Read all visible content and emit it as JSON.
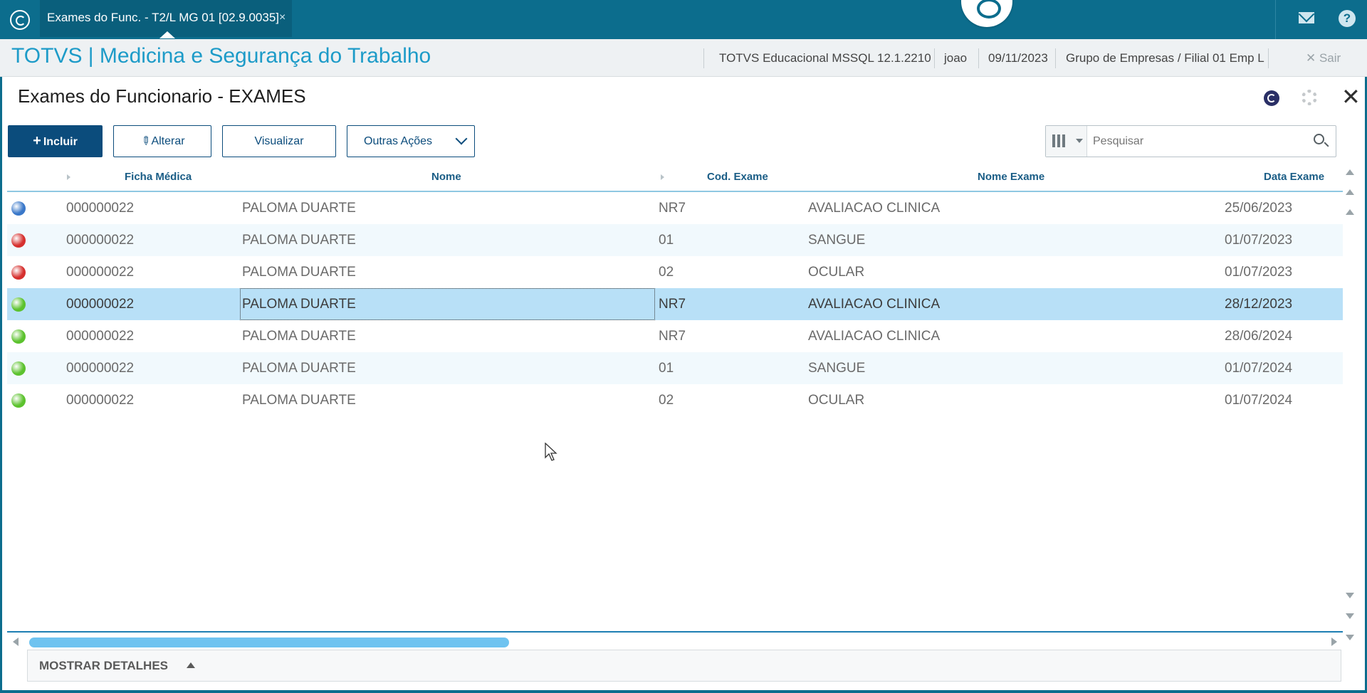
{
  "topbar": {
    "tab_label": "Exames do Func. - T2/L MG 01  [02.9.0035]",
    "tab_close": "×"
  },
  "header": {
    "title": "TOTVS | Medicina e Segurança do Trabalho",
    "environment": "TOTVS Educacional MSSQL 12.1.2210",
    "user": "joao",
    "date": "09/11/2023",
    "company": "Grupo de Empresas / Filial 01 Emp L",
    "exit_label": "Sair"
  },
  "page": {
    "title": "Exames do Funcionario - EXAMES"
  },
  "toolbar": {
    "include_label": "Incluir",
    "edit_label": "Alterar",
    "view_label": "Visualizar",
    "other_label": "Outras Ações"
  },
  "search": {
    "placeholder": "Pesquisar"
  },
  "grid": {
    "columns": [
      "Ficha Médica",
      "Nome",
      "Cod. Exame",
      "Nome Exame",
      "Data Exame"
    ],
    "rows": [
      {
        "status": "blue",
        "ficha": "000000022",
        "nome": "PALOMA DUARTE",
        "cod": "NR7",
        "exame": "AVALIACAO CLINICA",
        "data": "25/06/2023"
      },
      {
        "status": "red",
        "ficha": "000000022",
        "nome": "PALOMA DUARTE",
        "cod": "01",
        "exame": "SANGUE",
        "data": "01/07/2023"
      },
      {
        "status": "red",
        "ficha": "000000022",
        "nome": "PALOMA DUARTE",
        "cod": "02",
        "exame": "OCULAR",
        "data": "01/07/2023"
      },
      {
        "status": "green",
        "ficha": "000000022",
        "nome": "PALOMA DUARTE",
        "cod": "NR7",
        "exame": "AVALIACAO CLINICA",
        "data": "28/12/2023"
      },
      {
        "status": "green",
        "ficha": "000000022",
        "nome": "PALOMA DUARTE",
        "cod": "NR7",
        "exame": "AVALIACAO CLINICA",
        "data": "28/06/2024"
      },
      {
        "status": "green",
        "ficha": "000000022",
        "nome": "PALOMA DUARTE",
        "cod": "01",
        "exame": "SANGUE",
        "data": "01/07/2024"
      },
      {
        "status": "green",
        "ficha": "000000022",
        "nome": "PALOMA DUARTE",
        "cod": "02",
        "exame": "OCULAR",
        "data": "01/07/2024"
      }
    ],
    "selected_row": 3
  },
  "details": {
    "label": "MOSTRAR DETALHES"
  },
  "colors": {
    "topbar": "#0c6d8d",
    "primary": "#0b4c7c",
    "title_accent": "#1d9bc8",
    "selected_row": "#b8e0f7",
    "status_blue": "#3a78c9",
    "status_red": "#d6302e",
    "status_green": "#5cc22e"
  },
  "icons": {
    "app": "totvs-logo-icon",
    "chat": "chat-bubble-icon",
    "mail": "mail-icon",
    "help": "help-icon",
    "settings": "gear-icon",
    "close": "close-icon",
    "search": "search-icon",
    "columns": "columns-icon"
  }
}
